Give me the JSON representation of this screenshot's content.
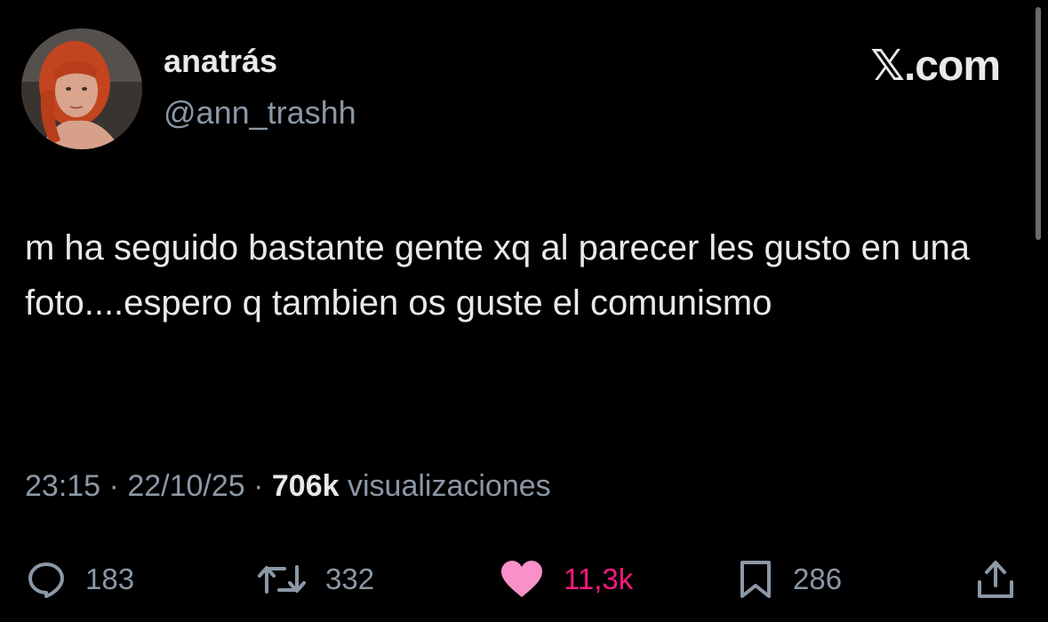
{
  "author": {
    "display_name": "anatrás",
    "handle": "@ann_trashh",
    "avatar_icon": "profile-photo"
  },
  "brand": {
    "label": "𝕏.com"
  },
  "tweet": {
    "text": "m ha seguido bastante gente xq al parecer les gusto en una foto....espero q tambien os guste el comunismo",
    "time": "23:15",
    "separator": " · ",
    "date": "22/10/25",
    "views_count": "706k",
    "views_label": "visualizaciones"
  },
  "actions": {
    "replies": {
      "icon": "reply-icon",
      "count": "183"
    },
    "retweets": {
      "icon": "retweet-icon",
      "count": "332"
    },
    "likes": {
      "icon": "heart-icon",
      "count": "11,3k",
      "color": "#f91880"
    },
    "bookmarks": {
      "icon": "bookmark-icon",
      "count": "286"
    },
    "share": {
      "icon": "share-icon"
    }
  },
  "colors": {
    "background": "#000000",
    "text_primary": "#e7e9ea",
    "text_secondary": "#8b98a5",
    "like_accent": "#f91880"
  }
}
